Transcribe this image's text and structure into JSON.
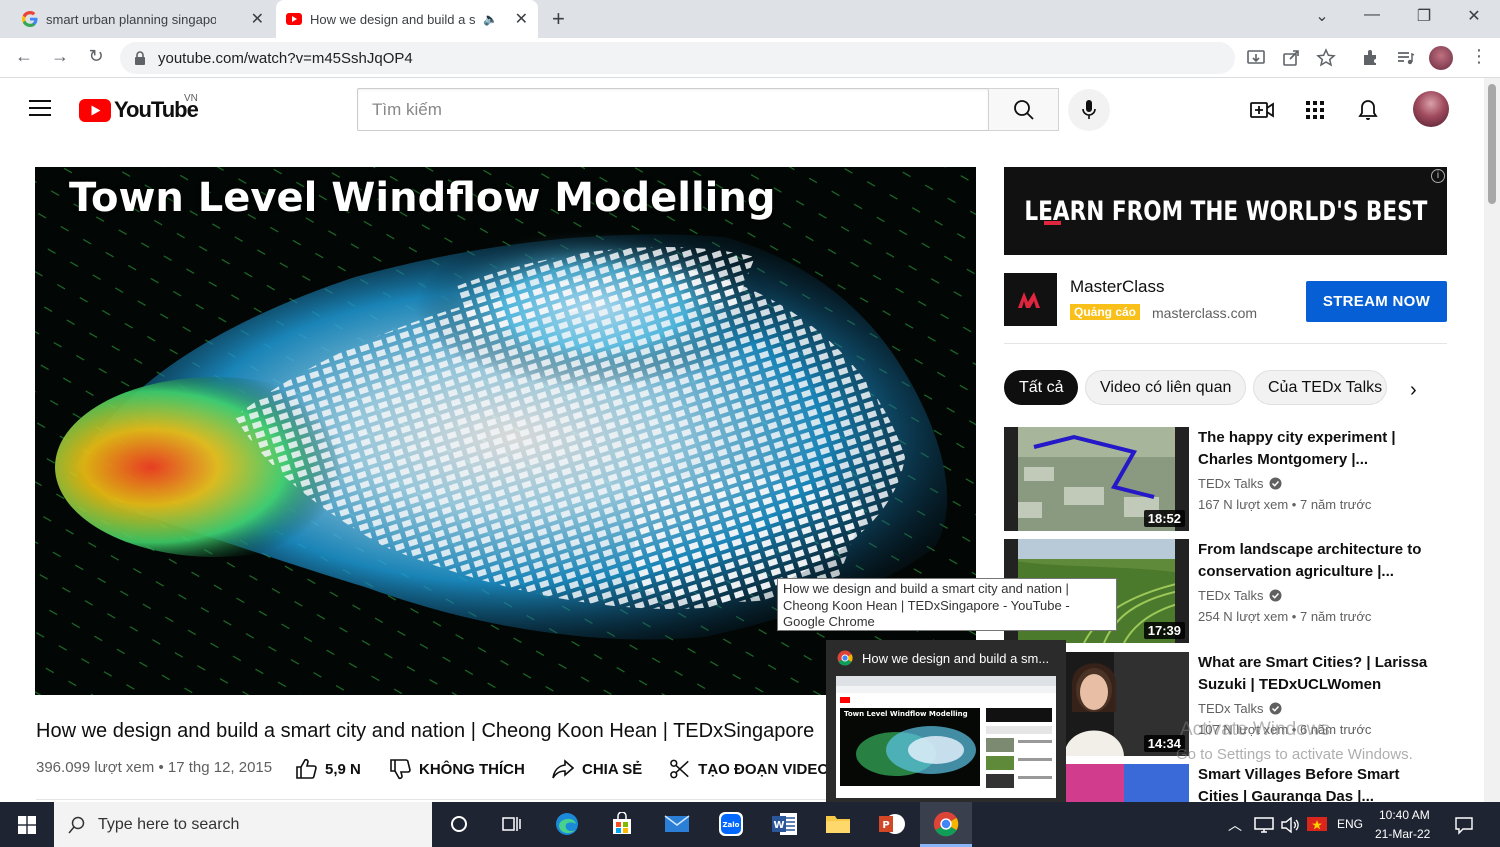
{
  "browser": {
    "tabs": [
      {
        "title": "smart urban planning singapore -",
        "active": false
      },
      {
        "title": "How we design and build a s",
        "active": true
      }
    ],
    "url": "youtube.com/watch?v=m45SshJqOP4"
  },
  "youtube": {
    "logo_text": "YouTube",
    "country": "VN",
    "search_placeholder": "Tìm kiếm"
  },
  "player": {
    "overlay_title": "Town Level Windflow Modelling"
  },
  "video": {
    "title": "How we design and build a smart city and nation | Cheong Koon Hean | TEDxSingapore",
    "meta": "396.099 lượt xem • 17 thg 12, 2015",
    "like_count": "5,9 N",
    "dislike_label": "KHÔNG THÍCH",
    "share_label": "CHIA SẺ",
    "clip_label": "TẠO ĐOẠN VIDEO"
  },
  "ad": {
    "banner_text": "LEARN FROM THE WORLD'S BEST",
    "brand": "MasterClass",
    "tag": "Quảng cáo",
    "domain": "masterclass.com",
    "cta": "STREAM NOW",
    "info": "i"
  },
  "chips": [
    {
      "label": "Tất cả",
      "active": true
    },
    {
      "label": "Video có liên quan",
      "active": false
    },
    {
      "label": "Của TEDx Talks",
      "active": false
    }
  ],
  "recommendations": [
    {
      "title": "The happy city experiment | Charles Montgomery |...",
      "channel": "TEDx Talks",
      "stats": "167 N lượt xem • 7 năm trước",
      "duration": "18:52"
    },
    {
      "title": "From landscape architecture to conservation agriculture |...",
      "channel": "TEDx Talks",
      "stats": "254 N lượt xem • 7 năm trước",
      "duration": "17:39"
    },
    {
      "title": "What are Smart Cities? | Larissa Suzuki | TEDxUCLWomen",
      "channel": "TEDx Talks",
      "stats": "107 N lượt xem • 6 năm trước",
      "duration": "14:34"
    },
    {
      "title": "Smart Villages Before Smart Cities | Gauranga Das |...",
      "channel": "",
      "stats": "",
      "duration": ""
    }
  ],
  "tooltip": {
    "text": "How we design and build a smart city and nation | Cheong Koon Hean | TEDxSingapore - YouTube - Google Chrome"
  },
  "preview": {
    "title": "How we design and build a sm...",
    "inner_title": "Town Level Windflow Modelling"
  },
  "watermark": {
    "line1": "Activate Windows",
    "line2": "Go to Settings to activate Windows."
  },
  "taskbar": {
    "search_placeholder": "Type here to search",
    "lang": "ENG",
    "time": "10:40 AM",
    "date": "21-Mar-22"
  },
  "colors": {
    "yt_red": "#ff0000",
    "cta_blue": "#065fd4",
    "ad_tag": "#f9c01a",
    "taskbar": "#1f2432"
  }
}
